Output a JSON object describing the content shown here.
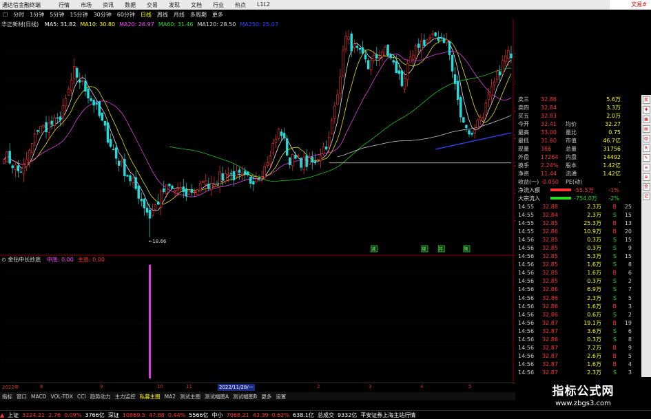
{
  "titlebar": {
    "app_name": "通达信金融终端",
    "menu": [
      "行情",
      "市场",
      "资讯",
      "数据",
      "交易",
      "发现",
      "文档",
      "行业",
      "热点",
      "L1L2"
    ],
    "right_label": "文易#"
  },
  "periods": {
    "items": [
      "分时",
      "1分钟",
      "5分钟",
      "15分钟",
      "30分钟",
      "60分钟",
      "日线",
      "周线",
      "月线",
      "多周期",
      "更多"
    ],
    "selected": "日线"
  },
  "stock": {
    "name": "华正新材(日线)"
  },
  "ma_legend": [
    {
      "label": "MA5: 31.82",
      "color": "#ffffff"
    },
    {
      "label": "MA10: 30.80",
      "color": "#ffff00"
    },
    {
      "label": "MA20: 26.97",
      "color": "#ff44ff"
    },
    {
      "label": "MA60: 31.46",
      "color": "#22dd22"
    },
    {
      "label": "MA120: 28.50",
      "color": "#dddddd"
    },
    {
      "label": "MA250: 25.07",
      "color": "#3344ff"
    }
  ],
  "indicator": {
    "name": "金钻中长抄底",
    "labels": [
      {
        "text": "中底: 0.00",
        "color": "#ff44ff"
      },
      {
        "text": "主底: 0.00",
        "color": "#ff3333"
      }
    ]
  },
  "chart_data": [
    {
      "type": "candlestick",
      "title": "华正新材(日线)",
      "ylim": [
        18,
        34
      ],
      "yticks": [
        20.0,
        22.0,
        24.0,
        26.0,
        28.0,
        30.0,
        32.0
      ],
      "low_annotation": {
        "text": "18.66",
        "value": 18.66,
        "index": 52
      },
      "markers": [
        {
          "text": "减",
          "index": 132
        },
        {
          "text": "增",
          "index": 150
        },
        {
          "text": "持",
          "index": 156
        },
        {
          "text": "限",
          "index": 165
        }
      ],
      "anchors": [
        [
          0,
          24.8
        ],
        [
          6,
          23.2
        ],
        [
          12,
          26.5
        ],
        [
          20,
          27.2
        ],
        [
          25,
          30.8
        ],
        [
          32,
          28.5
        ],
        [
          40,
          24.5
        ],
        [
          46,
          22.6
        ],
        [
          52,
          20.2
        ],
        [
          58,
          22.4
        ],
        [
          64,
          21.8
        ],
        [
          72,
          22.5
        ],
        [
          80,
          23.3
        ],
        [
          88,
          22.8
        ],
        [
          94,
          23.9
        ],
        [
          98,
          26.8
        ],
        [
          102,
          24.4
        ],
        [
          110,
          24.0
        ],
        [
          116,
          25.8
        ],
        [
          122,
          33.2
        ],
        [
          130,
          31.2
        ],
        [
          136,
          32.5
        ],
        [
          142,
          30.0
        ],
        [
          148,
          32.8
        ],
        [
          154,
          33.4
        ],
        [
          158,
          33.1
        ],
        [
          162,
          28.5
        ],
        [
          166,
          26.0
        ],
        [
          172,
          28.2
        ],
        [
          178,
          31.5
        ],
        [
          181,
          32.2
        ]
      ],
      "ma_series": [
        {
          "name": "MA5",
          "window": 5,
          "color": "#ffffff"
        },
        {
          "name": "MA10",
          "window": 10,
          "color": "#ffff00"
        },
        {
          "name": "MA20",
          "window": 20,
          "color": "#ff44ff"
        },
        {
          "name": "MA60",
          "window": 60,
          "color": "#22dd22"
        },
        {
          "name": "MA120",
          "window": 120,
          "color": "#dddddd"
        }
      ],
      "trendline": {
        "from": [
          116,
          24.1
        ],
        "to": [
          181,
          24.1
        ],
        "color": "#dddddd"
      },
      "blue_line": {
        "from": [
          154,
          25.1
        ],
        "to": [
          181,
          26.3
        ],
        "color": "#3344ff"
      }
    },
    {
      "type": "bar",
      "title": "金钻中长抄底",
      "ylim": [
        0,
        3.2
      ],
      "yticks": [
        0.5,
        1.0,
        1.5,
        2.0,
        2.5,
        3.0
      ],
      "bar": {
        "index": 52,
        "value": 3.15,
        "color": "#e040e0"
      }
    }
  ],
  "datebar": [
    {
      "text": "2022年",
      "x": 3
    },
    {
      "text": "8",
      "x": 58
    },
    {
      "text": "9",
      "x": 145
    },
    {
      "text": "10",
      "x": 228
    },
    {
      "text": "11",
      "x": 270
    },
    {
      "text": "2022/11/28/一",
      "x": 316,
      "highlight": true
    },
    {
      "text": "2",
      "x": 460
    },
    {
      "text": "3",
      "x": 535
    },
    {
      "text": "4",
      "x": 610
    },
    {
      "text": "5",
      "x": 680
    }
  ],
  "tabs": {
    "items": [
      "指标",
      "窗口",
      "MACD",
      "VOL-TDX",
      "CCI",
      "趋势动力",
      "主力监控",
      "私募主图",
      "MA2",
      "测试主图",
      "测试幅图A",
      "测试幅图B",
      "更多",
      "设置"
    ],
    "selected": "私募主图"
  },
  "quote": {
    "rows": [
      [
        "卖三",
        "32.86",
        "",
        "5.6万"
      ],
      [
        "卖四",
        "32.84",
        "",
        "3.3万"
      ],
      [
        "买五",
        "32.83",
        "",
        "2.0万"
      ],
      [
        "今开",
        "32.41",
        "均价",
        "32.27"
      ],
      [
        "最高",
        "33.00",
        "量比",
        "0.75"
      ],
      [
        "最低",
        "31.60",
        "市值",
        "46.7亿"
      ],
      [
        "现量",
        "386",
        "总量",
        "31756"
      ],
      [
        "外盘",
        "17264",
        "内盘",
        "14492"
      ],
      [
        "换手",
        "2.24%",
        "股本",
        "1.42亿"
      ],
      [
        "净资",
        "11.44",
        "流通",
        "1.42亿"
      ],
      [
        "收益(一)",
        "-0.050",
        "PE(动)",
        "-"
      ]
    ],
    "flows": [
      {
        "label": "净流入额",
        "value": "-55.5万",
        "pct": "-1%",
        "color": "#ff3333"
      },
      {
        "label": "大宗流入",
        "value": "-754.0万",
        "pct": "-2%",
        "color": "#22dd22"
      }
    ]
  },
  "ticks": [
    [
      "14:55",
      "32.88",
      "2.3万",
      "B",
      "25"
    ],
    [
      "14:55",
      "32.84",
      "2.3万",
      "S",
      "15"
    ],
    [
      "14:55",
      "32.85",
      "25.3万",
      "B",
      "13"
    ],
    [
      "14:55",
      "32.86",
      "10.9万",
      "B",
      "20"
    ],
    [
      "14:56",
      "32.85",
      "0.3万",
      "S",
      "15"
    ],
    [
      "14:56",
      "32.85",
      "0.3万",
      "S",
      "9"
    ],
    [
      "14:56",
      "32.85",
      "5.3万",
      "S",
      "15"
    ],
    [
      "14:56",
      "32.85",
      "1.6万",
      "S",
      "8"
    ],
    [
      "14:56",
      "32.85",
      "1.6万",
      "B",
      "6"
    ],
    [
      "14:56",
      "32.85",
      "0.3万",
      "S",
      "2"
    ],
    [
      "14:56",
      "32.86",
      "6.9万",
      "S",
      "7"
    ],
    [
      "14:56",
      "32.86",
      "2.3万",
      "S",
      "5"
    ],
    [
      "14:56",
      "32.86",
      "1.6万",
      "B",
      "3"
    ],
    [
      "14:56",
      "32.86",
      "0.6万",
      "S",
      "2"
    ],
    [
      "14:56",
      "32.87",
      "19.1万",
      "B",
      "19"
    ],
    [
      "14:56",
      "32.87",
      "3.6万",
      "S",
      "6"
    ],
    [
      "14:56",
      "32.86",
      "0.3万",
      "S",
      "8"
    ],
    [
      "14:56",
      "32.87",
      "7.2万",
      "B",
      "9"
    ],
    [
      "14:56",
      "32.87",
      "2.6万",
      "B",
      "5"
    ],
    [
      "14:56",
      "32.87",
      "1.6万",
      "B",
      "4"
    ],
    [
      "14:56",
      "32.87",
      "2.3万",
      "S",
      "3"
    ],
    [
      "14:56",
      "32.87",
      "1.6万",
      "B",
      "2"
    ]
  ],
  "bottombar": [
    {
      "text": "上证",
      "color": "#ffffff"
    },
    {
      "text": "3224.21",
      "color": "#ff3333"
    },
    {
      "text": "2.76",
      "color": "#ff3333"
    },
    {
      "text": "0.09%",
      "color": "#ff3333"
    },
    {
      "text": "3766亿",
      "color": "#ffffff"
    },
    {
      "text": "深证",
      "color": "#ffffff"
    },
    {
      "text": "10869.5",
      "color": "#ff3333"
    },
    {
      "text": "47.88",
      "color": "#ff3333"
    },
    {
      "text": "0.44%",
      "color": "#ff3333"
    },
    {
      "text": "5566亿",
      "color": "#ffffff"
    },
    {
      "text": "中小",
      "color": "#ffffff"
    },
    {
      "text": "7068.21",
      "color": "#ff3333"
    },
    {
      "text": "43.39",
      "color": "#ff3333"
    },
    {
      "text": "0.62%",
      "color": "#ff3333"
    },
    {
      "text": "638.1亿",
      "color": "#ffffff"
    },
    {
      "text": "总成交",
      "color": "#ffffff"
    },
    {
      "text": "9332亿",
      "color": "#ffffff"
    },
    {
      "text": "平安证券上海主站行情",
      "color": "#ffffff"
    }
  ],
  "watermark": {
    "line1": "指标公式网",
    "line2": "www.zbgs3.com"
  },
  "colors": {
    "up": "#ff3333",
    "down": "#22dddd",
    "grid": "#550000"
  }
}
